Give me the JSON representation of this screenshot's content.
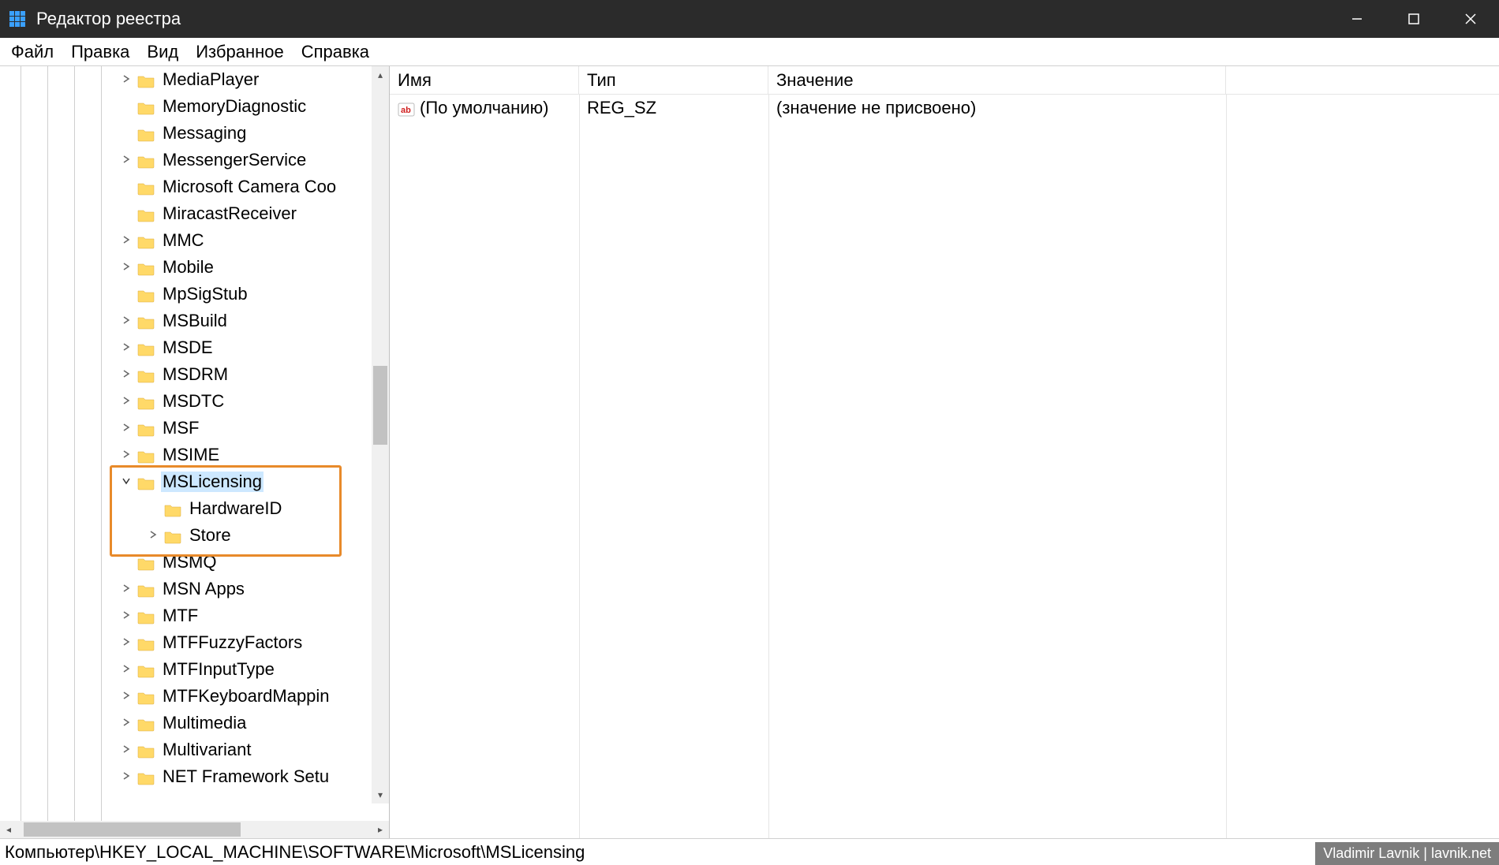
{
  "titlebar": {
    "title": "Редактор реестра"
  },
  "menu": {
    "file": "Файл",
    "edit": "Правка",
    "view": "Вид",
    "favorites": "Избранное",
    "help": "Справка"
  },
  "tree": {
    "items": [
      {
        "label": "MediaPlayer",
        "expander": "›",
        "depth": 0
      },
      {
        "label": "MemoryDiagnostic",
        "expander": "",
        "depth": 0
      },
      {
        "label": "Messaging",
        "expander": "",
        "depth": 0
      },
      {
        "label": "MessengerService",
        "expander": "›",
        "depth": 0
      },
      {
        "label": "Microsoft Camera Coo",
        "expander": "",
        "depth": 0
      },
      {
        "label": "MiracastReceiver",
        "expander": "",
        "depth": 0
      },
      {
        "label": "MMC",
        "expander": "›",
        "depth": 0
      },
      {
        "label": "Mobile",
        "expander": "›",
        "depth": 0
      },
      {
        "label": "MpSigStub",
        "expander": "",
        "depth": 0
      },
      {
        "label": "MSBuild",
        "expander": "›",
        "depth": 0
      },
      {
        "label": "MSDE",
        "expander": "›",
        "depth": 0
      },
      {
        "label": "MSDRM",
        "expander": "›",
        "depth": 0
      },
      {
        "label": "MSDTC",
        "expander": "›",
        "depth": 0
      },
      {
        "label": "MSF",
        "expander": "›",
        "depth": 0
      },
      {
        "label": "MSIME",
        "expander": "›",
        "depth": 0
      },
      {
        "label": "MSLicensing",
        "expander": "⌄",
        "depth": 0,
        "selected": true
      },
      {
        "label": "HardwareID",
        "expander": "",
        "depth": 1
      },
      {
        "label": "Store",
        "expander": "›",
        "depth": 1
      },
      {
        "label": "MSMQ",
        "expander": "",
        "depth": 0
      },
      {
        "label": "MSN Apps",
        "expander": "›",
        "depth": 0
      },
      {
        "label": "MTF",
        "expander": "›",
        "depth": 0
      },
      {
        "label": "MTFFuzzyFactors",
        "expander": "›",
        "depth": 0
      },
      {
        "label": "MTFInputType",
        "expander": "›",
        "depth": 0
      },
      {
        "label": "MTFKeyboardMappin",
        "expander": "›",
        "depth": 0
      },
      {
        "label": "Multimedia",
        "expander": "›",
        "depth": 0
      },
      {
        "label": "Multivariant",
        "expander": "›",
        "depth": 0
      },
      {
        "label": "NET Framework Setu",
        "expander": "›",
        "depth": 0
      }
    ]
  },
  "listview": {
    "columns": {
      "name": "Имя",
      "type": "Тип",
      "value": "Значение"
    },
    "row": {
      "name": "(По умолчанию)",
      "type": "REG_SZ",
      "value": "(значение не присвоено)"
    },
    "col_widths": {
      "name": 240,
      "type": 240,
      "value": 580
    }
  },
  "statusbar": {
    "path": "Компьютер\\HKEY_LOCAL_MACHINE\\SOFTWARE\\Microsoft\\MSLicensing"
  },
  "watermark": {
    "text": "Vladimir Lavnik | lavnik.net"
  },
  "colors": {
    "accent": "#0078d4",
    "highlight": "#cde8ff",
    "annotation": "#e88a2a"
  }
}
